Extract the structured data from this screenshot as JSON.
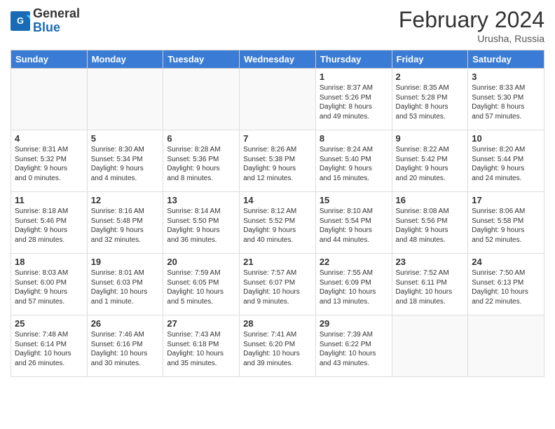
{
  "header": {
    "logo_general": "General",
    "logo_blue": "Blue",
    "month_title": "February 2024",
    "location": "Urusha, Russia"
  },
  "weekdays": [
    "Sunday",
    "Monday",
    "Tuesday",
    "Wednesday",
    "Thursday",
    "Friday",
    "Saturday"
  ],
  "weeks": [
    [
      {
        "day": "",
        "content": ""
      },
      {
        "day": "",
        "content": ""
      },
      {
        "day": "",
        "content": ""
      },
      {
        "day": "",
        "content": ""
      },
      {
        "day": "1",
        "content": "Sunrise: 8:37 AM\nSunset: 5:26 PM\nDaylight: 8 hours\nand 49 minutes."
      },
      {
        "day": "2",
        "content": "Sunrise: 8:35 AM\nSunset: 5:28 PM\nDaylight: 8 hours\nand 53 minutes."
      },
      {
        "day": "3",
        "content": "Sunrise: 8:33 AM\nSunset: 5:30 PM\nDaylight: 8 hours\nand 57 minutes."
      }
    ],
    [
      {
        "day": "4",
        "content": "Sunrise: 8:31 AM\nSunset: 5:32 PM\nDaylight: 9 hours\nand 0 minutes."
      },
      {
        "day": "5",
        "content": "Sunrise: 8:30 AM\nSunset: 5:34 PM\nDaylight: 9 hours\nand 4 minutes."
      },
      {
        "day": "6",
        "content": "Sunrise: 8:28 AM\nSunset: 5:36 PM\nDaylight: 9 hours\nand 8 minutes."
      },
      {
        "day": "7",
        "content": "Sunrise: 8:26 AM\nSunset: 5:38 PM\nDaylight: 9 hours\nand 12 minutes."
      },
      {
        "day": "8",
        "content": "Sunrise: 8:24 AM\nSunset: 5:40 PM\nDaylight: 9 hours\nand 16 minutes."
      },
      {
        "day": "9",
        "content": "Sunrise: 8:22 AM\nSunset: 5:42 PM\nDaylight: 9 hours\nand 20 minutes."
      },
      {
        "day": "10",
        "content": "Sunrise: 8:20 AM\nSunset: 5:44 PM\nDaylight: 9 hours\nand 24 minutes."
      }
    ],
    [
      {
        "day": "11",
        "content": "Sunrise: 8:18 AM\nSunset: 5:46 PM\nDaylight: 9 hours\nand 28 minutes."
      },
      {
        "day": "12",
        "content": "Sunrise: 8:16 AM\nSunset: 5:48 PM\nDaylight: 9 hours\nand 32 minutes."
      },
      {
        "day": "13",
        "content": "Sunrise: 8:14 AM\nSunset: 5:50 PM\nDaylight: 9 hours\nand 36 minutes."
      },
      {
        "day": "14",
        "content": "Sunrise: 8:12 AM\nSunset: 5:52 PM\nDaylight: 9 hours\nand 40 minutes."
      },
      {
        "day": "15",
        "content": "Sunrise: 8:10 AM\nSunset: 5:54 PM\nDaylight: 9 hours\nand 44 minutes."
      },
      {
        "day": "16",
        "content": "Sunrise: 8:08 AM\nSunset: 5:56 PM\nDaylight: 9 hours\nand 48 minutes."
      },
      {
        "day": "17",
        "content": "Sunrise: 8:06 AM\nSunset: 5:58 PM\nDaylight: 9 hours\nand 52 minutes."
      }
    ],
    [
      {
        "day": "18",
        "content": "Sunrise: 8:03 AM\nSunset: 6:00 PM\nDaylight: 9 hours\nand 57 minutes."
      },
      {
        "day": "19",
        "content": "Sunrise: 8:01 AM\nSunset: 6:03 PM\nDaylight: 10 hours\nand 1 minute."
      },
      {
        "day": "20",
        "content": "Sunrise: 7:59 AM\nSunset: 6:05 PM\nDaylight: 10 hours\nand 5 minutes."
      },
      {
        "day": "21",
        "content": "Sunrise: 7:57 AM\nSunset: 6:07 PM\nDaylight: 10 hours\nand 9 minutes."
      },
      {
        "day": "22",
        "content": "Sunrise: 7:55 AM\nSunset: 6:09 PM\nDaylight: 10 hours\nand 13 minutes."
      },
      {
        "day": "23",
        "content": "Sunrise: 7:52 AM\nSunset: 6:11 PM\nDaylight: 10 hours\nand 18 minutes."
      },
      {
        "day": "24",
        "content": "Sunrise: 7:50 AM\nSunset: 6:13 PM\nDaylight: 10 hours\nand 22 minutes."
      }
    ],
    [
      {
        "day": "25",
        "content": "Sunrise: 7:48 AM\nSunset: 6:14 PM\nDaylight: 10 hours\nand 26 minutes."
      },
      {
        "day": "26",
        "content": "Sunrise: 7:46 AM\nSunset: 6:16 PM\nDaylight: 10 hours\nand 30 minutes."
      },
      {
        "day": "27",
        "content": "Sunrise: 7:43 AM\nSunset: 6:18 PM\nDaylight: 10 hours\nand 35 minutes."
      },
      {
        "day": "28",
        "content": "Sunrise: 7:41 AM\nSunset: 6:20 PM\nDaylight: 10 hours\nand 39 minutes."
      },
      {
        "day": "29",
        "content": "Sunrise: 7:39 AM\nSunset: 6:22 PM\nDaylight: 10 hours\nand 43 minutes."
      },
      {
        "day": "",
        "content": ""
      },
      {
        "day": "",
        "content": ""
      }
    ]
  ]
}
